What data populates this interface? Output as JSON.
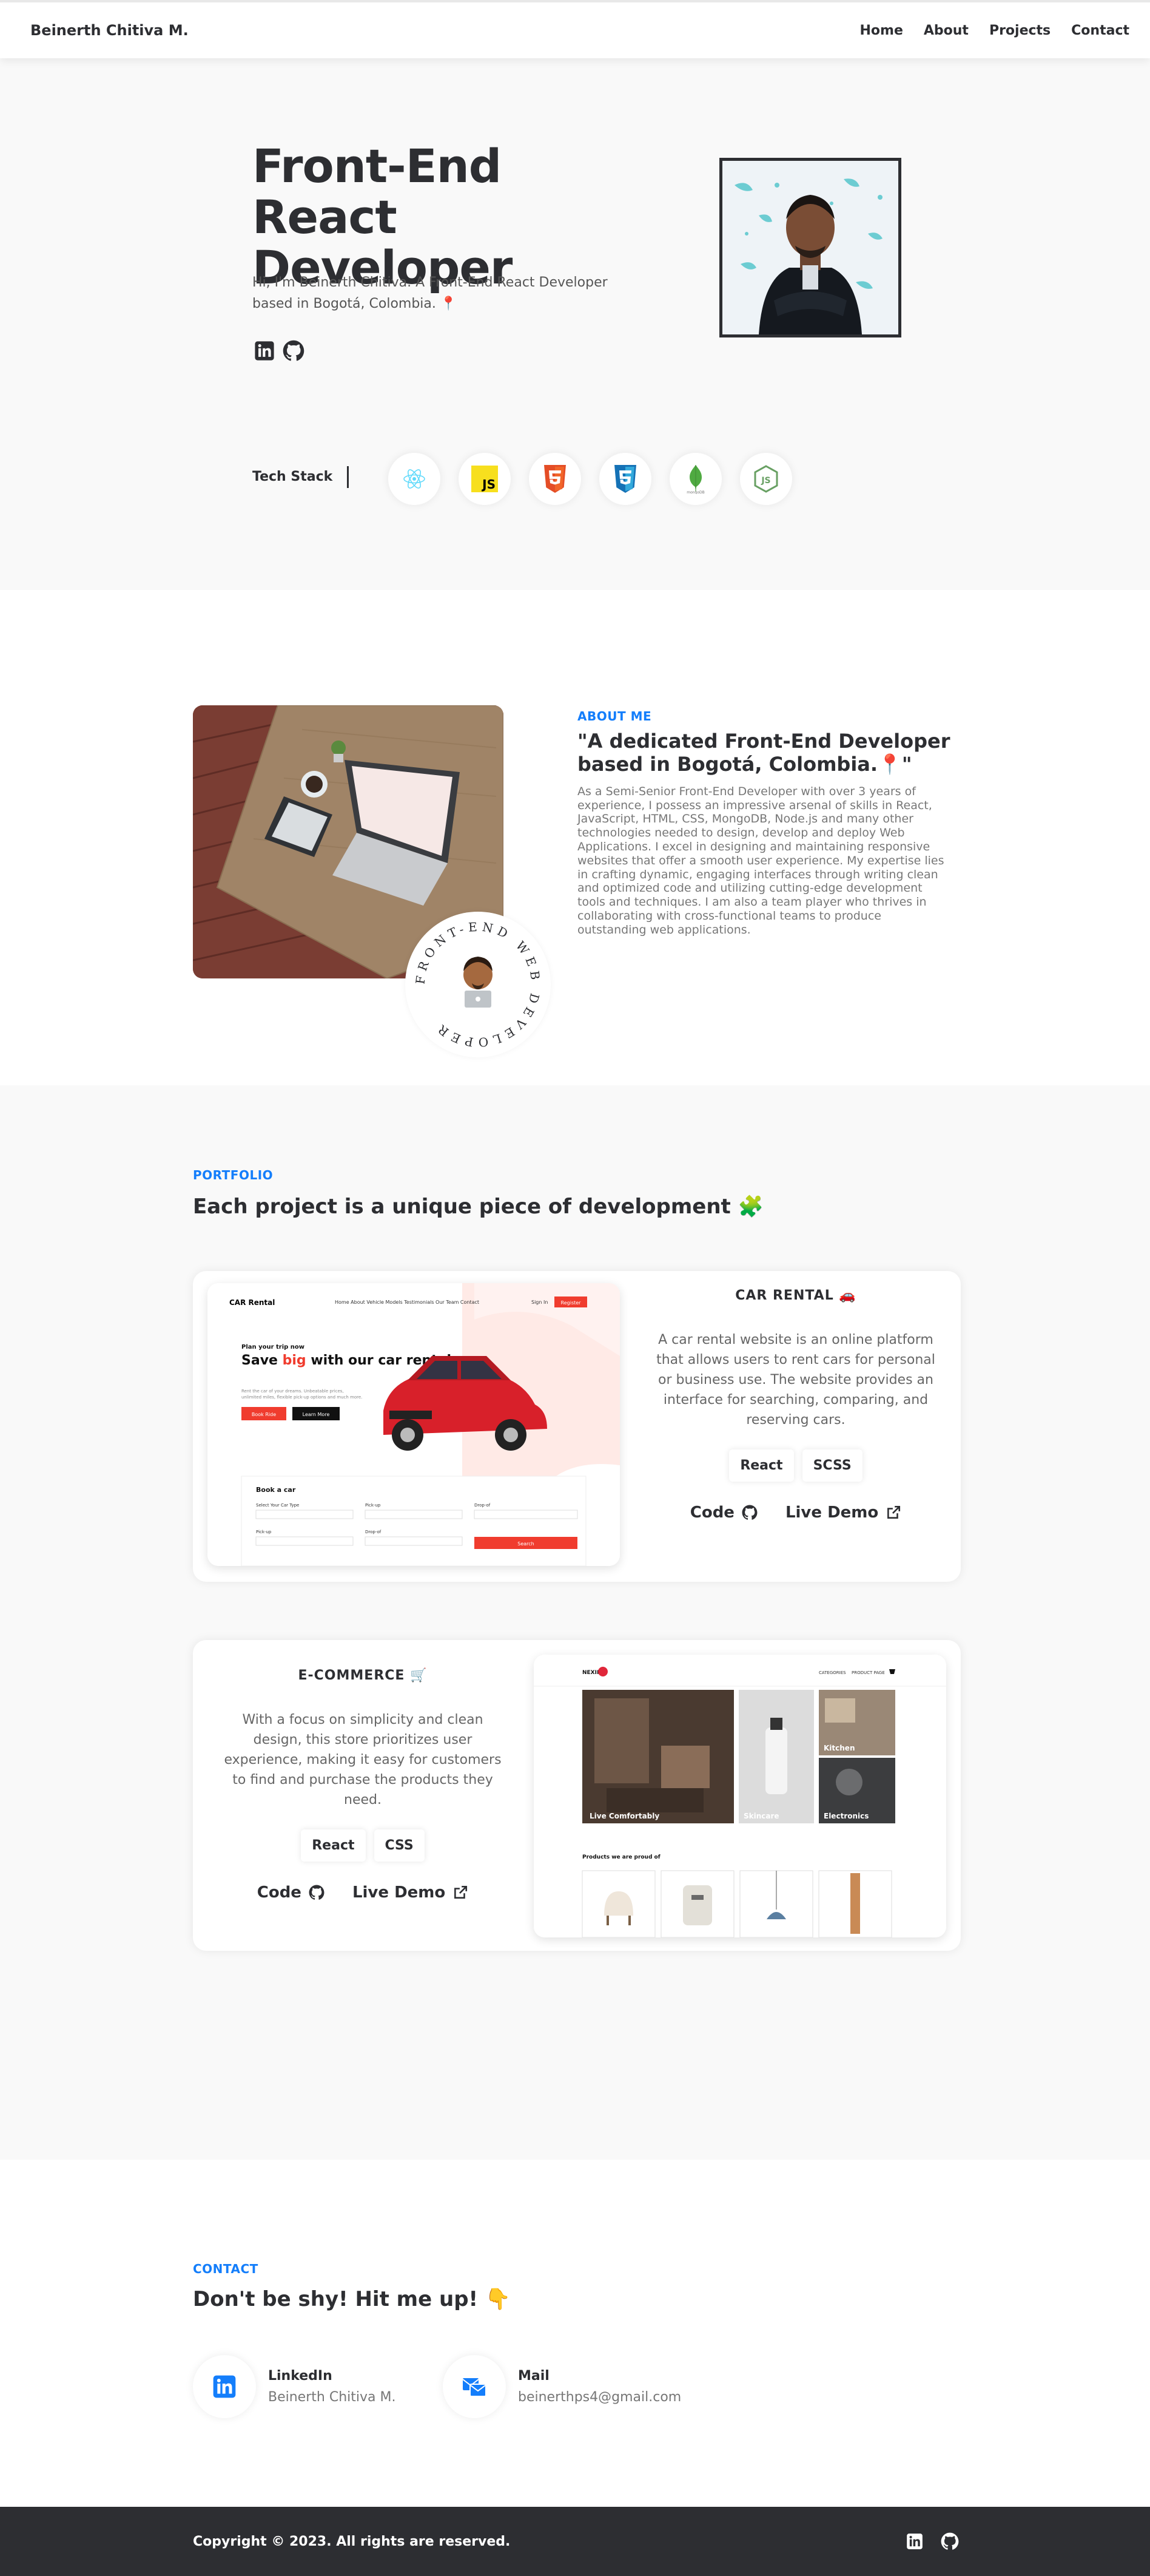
{
  "nav": {
    "brand": "Beinerth Chitiva M.",
    "links": [
      "Home",
      "About",
      "Projects",
      "Contact"
    ]
  },
  "hero": {
    "title": "Front-End React Developer",
    "subtitle": "Hi, I'm Beinerth Chitiva. A Front-End React Developer based in Bogotá, Colombia. 📍",
    "tech_label": "Tech Stack",
    "tech": [
      "react-icon",
      "javascript-icon",
      "html5-icon",
      "css3-icon",
      "mongodb-icon",
      "nodejs-icon"
    ]
  },
  "about": {
    "label": "ABOUT ME",
    "heading": "\"A dedicated Front-End Developer based in Bogotá, Colombia.📍\"",
    "body": "As a Semi-Senior Front-End Developer with over 3 years of experience, I possess an impressive arsenal of skills in React, JavaScript, HTML, CSS, MongoDB, Node.js and many other technologies needed to design, develop and deploy Web Applications. I excel in designing and maintaining responsive websites that offer a smooth user experience. My expertise lies in crafting dynamic, engaging interfaces through writing clean and optimized code and utilizing cutting-edge development tools and techniques. I am also a team player who thrives in collaborating with cross-functional teams to produce outstanding web applications.",
    "badge_text": "FRONT-END WEB DEVELOPER"
  },
  "portfolio": {
    "label": "PORTFOLIO",
    "title": "Each project is a unique piece of development 🧩",
    "projects": [
      {
        "title": "CAR RENTAL 🚗",
        "description": "A car rental website is an online platform that allows users to rent cars for personal or business use. The website provides an interface for searching, comparing, and reserving cars.",
        "tags": [
          "React",
          "SCSS"
        ],
        "code_label": "Code",
        "demo_label": "Live Demo",
        "shot": {
          "logo": "CAR Rental",
          "nav": [
            "Home",
            "About",
            "Vehicle Models",
            "Testimonials",
            "Our Team",
            "Contact"
          ],
          "signin": "Sign In",
          "register": "Register",
          "kicker": "Plan your trip now",
          "headline_pre": "Save ",
          "headline_hl": "big",
          "headline_post": " with our car rental",
          "blurb": "Rent the car of your dreams. Unbeatable prices, unlimited miles, flexible pick-up options and much more.",
          "book_btn": "Book Ride",
          "learn_btn": "Learn More",
          "book_title": "Book a car",
          "fields": [
            "Select Your Car Type",
            "Pick-up",
            "Drop-of",
            "Pick-up",
            "Drop-of"
          ],
          "search_btn": "Search"
        }
      },
      {
        "title": "E-COMMERCE 🛒",
        "description": "With a focus on simplicity and clean design, this store prioritizes user experience, making it easy for customers to find and purchase the products they need.",
        "tags": [
          "React",
          "CSS"
        ],
        "code_label": "Code",
        "demo_label": "Live Demo",
        "shot": {
          "logo": "NEXIMY",
          "nav": [
            "CATEGORIES",
            "PRODUCT PAGE"
          ],
          "tiles": [
            "Live Comfortably",
            "Skincare",
            "Kitchen",
            "Electronics"
          ],
          "products_title": "Products we are proud of"
        }
      }
    ]
  },
  "contact": {
    "label": "CONTACT",
    "title": "Don't be shy! Hit me up! 👇",
    "items": [
      {
        "name": "LinkedIn",
        "value": "Beinerth Chitiva M."
      },
      {
        "name": "Mail",
        "value": "beinerthps4@gmail.com"
      }
    ]
  },
  "footer": {
    "copyright": "Copyright © 2023. All rights are reserved."
  },
  "colors": {
    "accent": "#147efb",
    "dark": "#2d2e32",
    "car_red": "#f03c2e"
  }
}
